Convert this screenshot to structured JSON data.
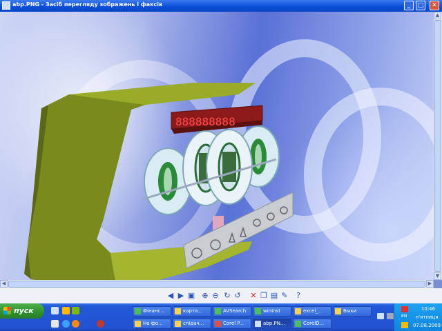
{
  "window": {
    "title": "abp.PNG - Засіб перегляду зображень і факсів",
    "minimize_label": "_",
    "maximize_label": "□",
    "close_label": "✕"
  },
  "image": {
    "display_text": "888888888",
    "colors": {
      "frame": "#7b8a1d",
      "display_bg": "#8c1a1a",
      "display_digits": "#ff4a4a",
      "ring_green": "#2b8a3a",
      "glass": "#d9ecf4",
      "background_blue": "#5a71d6"
    }
  },
  "viewer_toolbar": {
    "icons": [
      "prev-icon",
      "next-icon",
      "best-fit-icon",
      "zoom-in-icon",
      "zoom-out-icon",
      "rotate-cw-icon",
      "rotate-ccw-icon",
      "delete-icon",
      "copy-icon",
      "save-icon",
      "edit-icon",
      "help-icon"
    ]
  },
  "taskbar": {
    "start_label": "пуск",
    "row1": [
      "Фінанс...",
      "карта...",
      "AVSearch",
      "winInst",
      "excel_...",
      "Быки"
    ],
    "row2": [
      "На фо...",
      "спідач...",
      "Corel P...",
      "abp.PN...",
      "CorelD...",
      ""
    ],
    "active_task": "abp.PN...",
    "tray": {
      "language": "EN",
      "time": "10:46",
      "day": "п'ятниця",
      "date": "07.08.2009"
    }
  }
}
